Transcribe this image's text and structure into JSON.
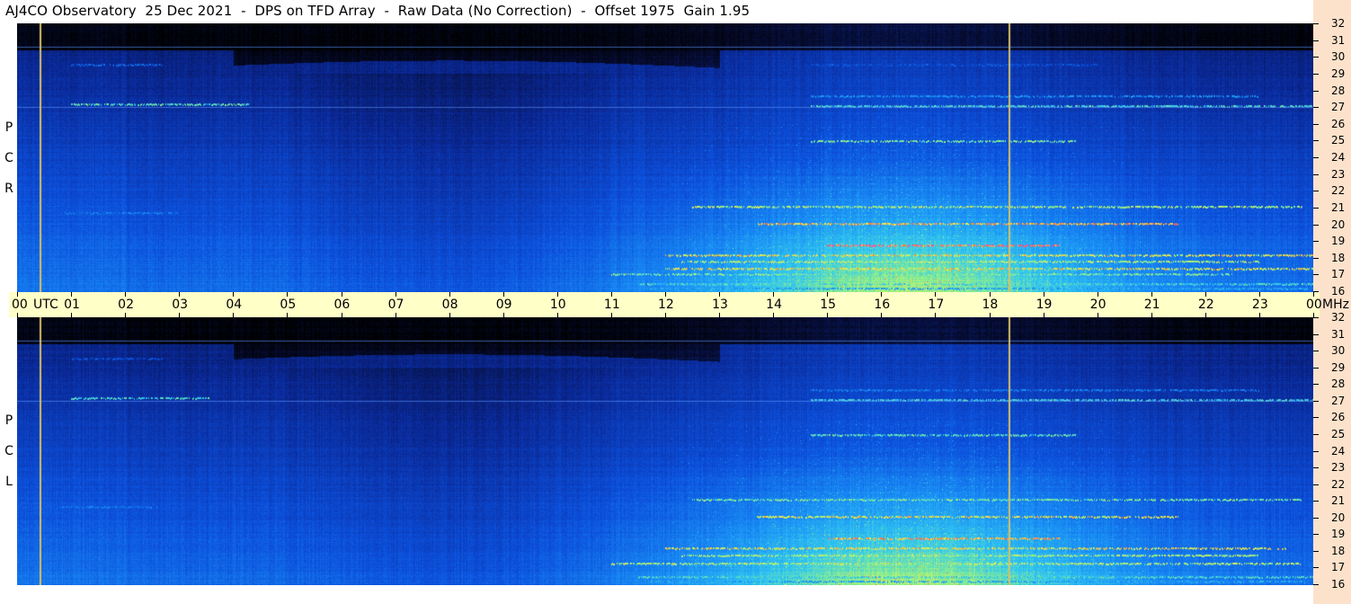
{
  "title": "AJ4CO Observatory  25 Dec 2021  -  DPS on TFD Array  -  Raw Data (No Correction)  -  Offset 1975  Gain 1.95",
  "colors": {
    "background": "#ffffff",
    "utc_band": "#ffffc8",
    "right_column": "#fde2cb",
    "marker_line": "#d8c066",
    "palette": [
      "#000000",
      "#040a30",
      "#0a2a8a",
      "#0b50d8",
      "#1a86f0",
      "#35c6f0",
      "#8ef08a",
      "#f0f050",
      "#f08040",
      "#ff40a0"
    ]
  },
  "chart_data": [
    {
      "type": "heatmap",
      "polarization_label": [
        "R",
        "C",
        "P"
      ],
      "x_axis": {
        "range_hours": [
          0,
          24
        ],
        "tick_labels": [
          "00",
          "UTC",
          "01",
          "02",
          "03",
          "04",
          "05",
          "06",
          "07",
          "08",
          "09",
          "10",
          "11",
          "12",
          "13",
          "14",
          "15",
          "16",
          "17",
          "18",
          "19",
          "20",
          "21",
          "22",
          "23",
          "00",
          "MHz"
        ]
      },
      "y_axis": {
        "range_mhz": [
          16,
          32
        ],
        "tick_labels": [
          "32",
          "31",
          "30",
          "29",
          "28",
          "27",
          "26",
          "25",
          "24",
          "23",
          "22",
          "21",
          "20",
          "19",
          "18",
          "17",
          "16"
        ]
      },
      "marker_times_utc": [
        0.42,
        18.35
      ],
      "bright_bands_mhz": [
        {
          "mhz": 27.2,
          "hours": [
            1.0,
            4.3
          ],
          "level": 0.72
        },
        {
          "mhz": 27.1,
          "hours": [
            14.7,
            24.0
          ],
          "level": 0.7
        },
        {
          "mhz": 27.7,
          "hours": [
            14.7,
            23.0
          ],
          "level": 0.55
        },
        {
          "mhz": 29.6,
          "hours": [
            1.0,
            2.7
          ],
          "level": 0.45
        },
        {
          "mhz": 29.6,
          "hours": [
            14.7,
            20.0
          ],
          "level": 0.4
        },
        {
          "mhz": 25.0,
          "hours": [
            14.7,
            19.6
          ],
          "level": 0.75
        },
        {
          "mhz": 21.1,
          "hours": [
            12.5,
            23.8
          ],
          "level": 0.8
        },
        {
          "mhz": 20.1,
          "hours": [
            13.7,
            21.5
          ],
          "level": 0.9
        },
        {
          "mhz": 20.7,
          "hours": [
            0.8,
            3.0
          ],
          "level": 0.5
        },
        {
          "mhz": 18.8,
          "hours": [
            15.0,
            19.3
          ],
          "level": 0.95
        },
        {
          "mhz": 18.2,
          "hours": [
            12.0,
            24.0
          ],
          "level": 0.85
        },
        {
          "mhz": 17.8,
          "hours": [
            12.3,
            23.0
          ],
          "level": 0.8
        },
        {
          "mhz": 17.4,
          "hours": [
            12.0,
            24.0
          ],
          "level": 0.85
        },
        {
          "mhz": 17.1,
          "hours": [
            11.0,
            22.5
          ],
          "level": 0.75
        },
        {
          "mhz": 16.5,
          "hours": [
            11.5,
            24.0
          ],
          "level": 0.7
        },
        {
          "mhz": 16.2,
          "hours": [
            11.7,
            23.9
          ],
          "level": 0.6
        }
      ]
    },
    {
      "type": "heatmap",
      "polarization_label": [
        "L",
        "C",
        "P"
      ],
      "x_axis": {
        "range_hours": [
          0,
          24
        ]
      },
      "y_axis": {
        "range_mhz": [
          16,
          32
        ],
        "tick_labels": [
          "32",
          "31",
          "30",
          "29",
          "28",
          "27",
          "26",
          "25",
          "24",
          "23",
          "22",
          "21",
          "20",
          "19",
          "18",
          "17",
          "16"
        ]
      },
      "marker_times_utc": [
        0.42,
        18.35
      ],
      "bright_bands_mhz": [
        {
          "mhz": 27.2,
          "hours": [
            1.0,
            3.6
          ],
          "level": 0.7
        },
        {
          "mhz": 27.1,
          "hours": [
            14.7,
            24.0
          ],
          "level": 0.68
        },
        {
          "mhz": 27.7,
          "hours": [
            14.7,
            23.0
          ],
          "level": 0.5
        },
        {
          "mhz": 29.6,
          "hours": [
            1.0,
            2.7
          ],
          "level": 0.4
        },
        {
          "mhz": 25.0,
          "hours": [
            14.7,
            19.6
          ],
          "level": 0.72
        },
        {
          "mhz": 21.1,
          "hours": [
            12.5,
            23.8
          ],
          "level": 0.75
        },
        {
          "mhz": 20.1,
          "hours": [
            13.7,
            21.5
          ],
          "level": 0.85
        },
        {
          "mhz": 20.7,
          "hours": [
            0.8,
            2.6
          ],
          "level": 0.5
        },
        {
          "mhz": 18.8,
          "hours": [
            15.0,
            19.3
          ],
          "level": 0.9
        },
        {
          "mhz": 18.2,
          "hours": [
            12.0,
            23.5
          ],
          "level": 0.85
        },
        {
          "mhz": 17.8,
          "hours": [
            12.3,
            23.0
          ],
          "level": 0.8
        },
        {
          "mhz": 17.3,
          "hours": [
            11.0,
            23.8
          ],
          "level": 0.8
        },
        {
          "mhz": 16.5,
          "hours": [
            11.5,
            24.0
          ],
          "level": 0.7
        },
        {
          "mhz": 16.2,
          "hours": [
            11.7,
            23.9
          ],
          "level": 0.6
        }
      ]
    }
  ]
}
